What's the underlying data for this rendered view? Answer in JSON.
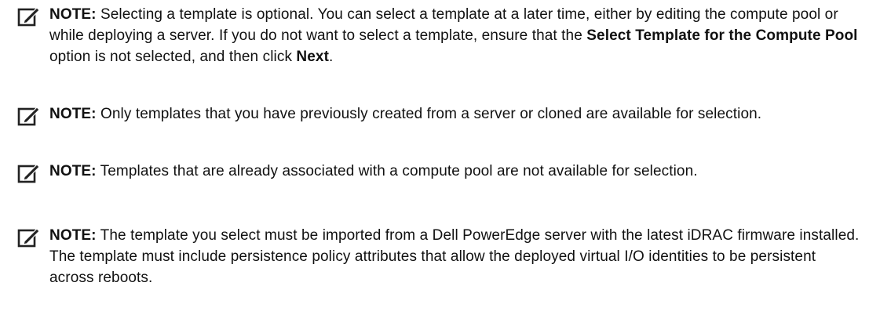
{
  "notes": [
    {
      "icon": "note-pencil-icon",
      "label": "NOTE:",
      "parts": [
        {
          "text": " Selecting a template is optional. You can select a template at a later time, either by editing the compute pool or while deploying a server. If you do not want to select a template, ensure that the ",
          "bold": false
        },
        {
          "text": "Select Template for the Compute Pool",
          "bold": true
        },
        {
          "text": " option is not selected, and then click ",
          "bold": false
        },
        {
          "text": "Next",
          "bold": true
        },
        {
          "text": ".",
          "bold": false
        }
      ]
    },
    {
      "icon": "note-pencil-icon",
      "label": "NOTE:",
      "parts": [
        {
          "text": " Only templates that you have previously created from a server or cloned are available for selection.",
          "bold": false
        }
      ]
    },
    {
      "icon": "note-pencil-icon",
      "label": "NOTE:",
      "parts": [
        {
          "text": " Templates that are already associated with a compute pool are not available for selection.",
          "bold": false
        }
      ]
    },
    {
      "icon": "note-pencil-icon",
      "label": "NOTE:",
      "parts": [
        {
          "text": " The template you select must be imported from a Dell PowerEdge server with the latest iDRAC firmware installed. The template must include persistence policy attributes that allow the deployed virtual I/O identities to be persistent across reboots.",
          "bold": false
        }
      ]
    }
  ]
}
